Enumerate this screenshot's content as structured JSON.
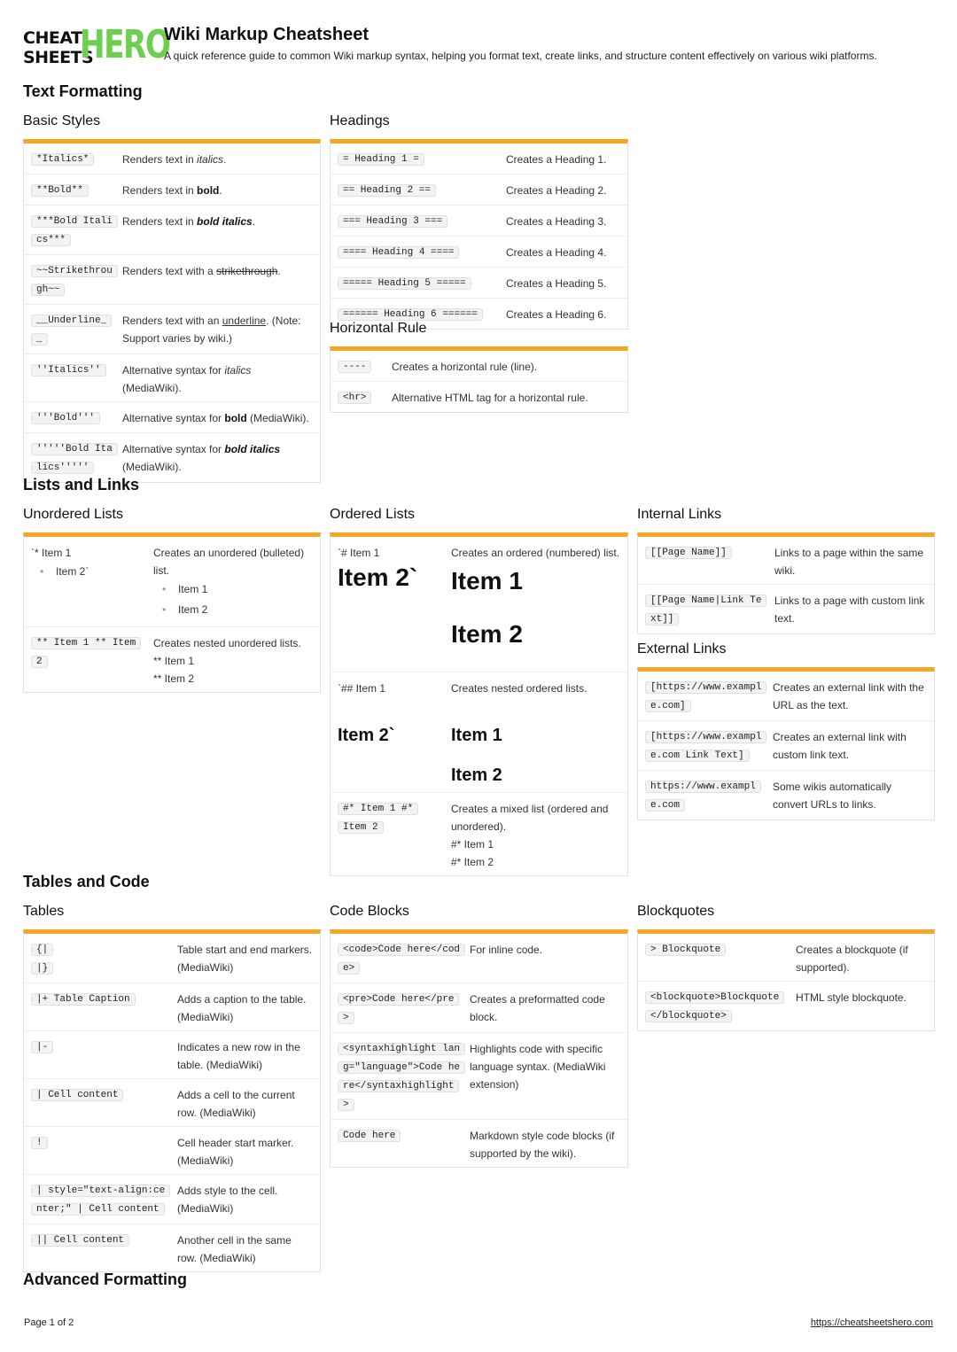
{
  "logo": {
    "left": "CHEAT\nSHEETS",
    "left_line1": "CHEAT",
    "left_line2": "SHEETS",
    "right": "HERO"
  },
  "header": {
    "title": "Wiki Markup Cheatsheet",
    "subtitle": "A quick reference guide to common Wiki markup syntax, helping you format text, create links, and structure content effectively on various wiki platforms."
  },
  "colors": {
    "accent": "#f5a623",
    "logo_green": "#6ccf4f"
  },
  "sections": {
    "text_formatting": "Text Formatting",
    "lists_links": "Lists and Links",
    "tables_code": "Tables and Code",
    "advanced": "Advanced Formatting"
  },
  "basic_styles": {
    "title": "Basic Styles",
    "rows": [
      {
        "code": "*Italics*",
        "pre": "Renders text in ",
        "em": "italics",
        "post": "."
      },
      {
        "code": "**Bold**",
        "pre": "Renders text in ",
        "em": "bold",
        "post": "."
      },
      {
        "code": "***Bold Italics***",
        "pre": "Renders text in ",
        "em": "bold italics",
        "post": "."
      },
      {
        "code": "~~Strikethrough~~",
        "pre": "Renders text with a ",
        "em": "strikethrough",
        "post": "."
      },
      {
        "code": "__Underline__",
        "pre": "Renders text with an ",
        "em": "underline",
        "post": ". (Note: Support varies by wiki.)"
      },
      {
        "code": "''Italics''",
        "pre": "Alternative syntax for ",
        "em": "italics",
        "post": " (MediaWiki)."
      },
      {
        "code": "'''Bold'''",
        "pre": "Alternative syntax for ",
        "em": "bold",
        "post": " (MediaWiki)."
      },
      {
        "code": "'''''Bold Italics'''''",
        "pre": "Alternative syntax for ",
        "em": "bold italics",
        "post": " (MediaWiki)."
      }
    ]
  },
  "headings": {
    "title": "Headings",
    "rows": [
      {
        "code": "= Heading 1 =",
        "desc": "Creates a Heading 1."
      },
      {
        "code": "== Heading 2 ==",
        "desc": "Creates a Heading 2."
      },
      {
        "code": "=== Heading 3 ===",
        "desc": "Creates a Heading 3."
      },
      {
        "code": "==== Heading 4 ==== ",
        "desc": "Creates a Heading 4."
      },
      {
        "code": "===== Heading 5 =====",
        "desc": "Creates a Heading 5."
      },
      {
        "code": "====== Heading 6 ======",
        "desc": "Creates a Heading 6."
      }
    ]
  },
  "horizontal_rule": {
    "title": "Horizontal Rule",
    "rows": [
      {
        "code": "----",
        "desc": "Creates a horizontal rule (line)."
      },
      {
        "code": "<hr>",
        "desc": "Alternative HTML tag for a horizontal rule."
      }
    ]
  },
  "unordered_lists": {
    "title": "Unordered Lists",
    "row1": {
      "left_line": "`* Item 1",
      "left_bullet": "Item 2`",
      "desc": "Creates an unordered (bulleted) list.",
      "bullets": [
        "Item 1",
        "Item 2"
      ]
    },
    "row2": {
      "code": "** Item 1 ** Item 2",
      "desc": "Creates nested unordered lists.",
      "lines": [
        "** Item 1",
        "** Item 2"
      ]
    }
  },
  "ordered_lists": {
    "title": "Ordered Lists",
    "row1": {
      "left_line": "`# Item 1",
      "left_big": "Item 2`",
      "desc": "Creates an ordered (numbered) list.",
      "big": [
        "Item 1",
        "Item 2"
      ]
    },
    "row2": {
      "left_line": "`## Item 1",
      "left_big": "Item 2`",
      "desc": "Creates nested ordered lists.",
      "big": [
        "Item 1",
        "Item 2"
      ]
    },
    "row3": {
      "code": "#* Item 1 #* Item 2",
      "desc": "Creates a mixed list (ordered and unordered).",
      "lines": [
        "#* Item 1",
        "#* Item 2"
      ]
    }
  },
  "internal_links": {
    "title": "Internal Links",
    "rows": [
      {
        "code": "[[Page Name]]",
        "desc": "Links to a page within the same wiki."
      },
      {
        "code": "[[Page Name|Link Text]]",
        "desc": "Links to a page with custom link text."
      }
    ]
  },
  "external_links": {
    "title": "External Links",
    "rows": [
      {
        "code": "[https://www.example.com]",
        "desc": "Creates an external link with the URL as the text."
      },
      {
        "code": "[https://www.example.com Link Text]",
        "desc": "Creates an external link with custom link text."
      },
      {
        "code": "https://www.example.com",
        "desc": "Some wikis automatically convert URLs to links."
      }
    ]
  },
  "tables": {
    "title": "Tables",
    "row1": {
      "codes": [
        "{|",
        "|}"
      ],
      "desc": "Table start and end markers. (MediaWiki)"
    },
    "rows": [
      {
        "code": "|+ Table Caption",
        "desc": "Adds a caption to the table. (MediaWiki)"
      },
      {
        "code": "|-",
        "desc": "Indicates a new row in the table. (MediaWiki)"
      },
      {
        "code": "| Cell content",
        "desc": "Adds a cell to the current row. (MediaWiki)"
      },
      {
        "code": "!",
        "desc": "Cell header start marker. (MediaWiki)"
      },
      {
        "code": "| style=\"text-align:center;\" | Cell content",
        "desc": "Adds style to the cell. (MediaWiki)"
      },
      {
        "code": "|| Cell content",
        "desc": "Another cell in the same row. (MediaWiki)"
      }
    ]
  },
  "code_blocks": {
    "title": "Code Blocks",
    "rows": [
      {
        "code": "<code>Code here</code>",
        "desc": "For inline code."
      },
      {
        "code": "<pre>Code here</pre>",
        "desc": "Creates a preformatted code block."
      },
      {
        "code": "<syntaxhighlight lang=\"language\">Code here</syntaxhighlight>",
        "desc": "Highlights code with specific language syntax. (MediaWiki extension)"
      },
      {
        "code": "Code here",
        "desc": "Markdown style code blocks (if supported by the wiki)."
      }
    ]
  },
  "blockquotes": {
    "title": "Blockquotes",
    "rows": [
      {
        "code": "> Blockquote",
        "desc": "Creates a blockquote (if supported)."
      },
      {
        "code": "<blockquote>Blockquote</blockquote>",
        "desc": "HTML style blockquote."
      }
    ]
  },
  "footer": {
    "page": "Page 1 of 2",
    "url": "https://cheatsheetshero.com"
  }
}
